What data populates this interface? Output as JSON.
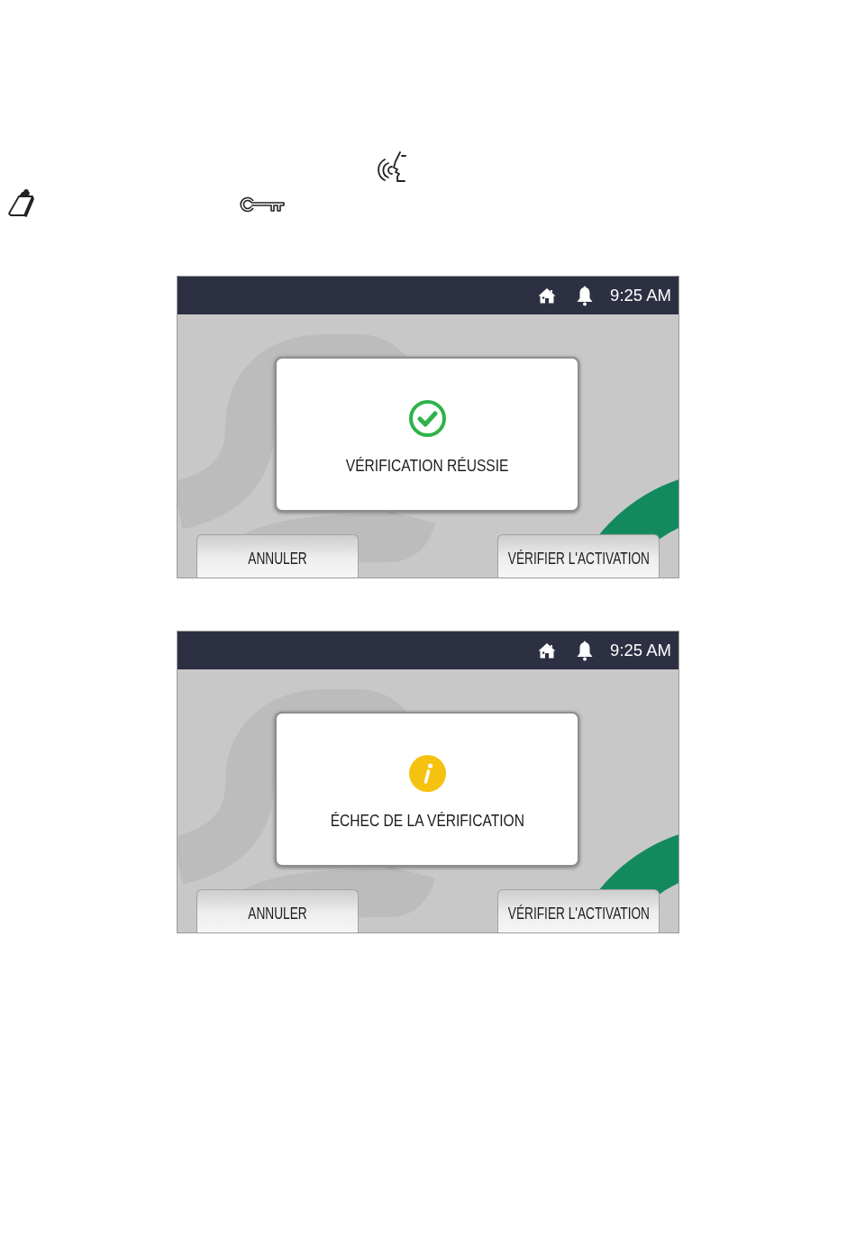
{
  "screens": [
    {
      "status_bar": {
        "time": "9:25 AM"
      },
      "dialog": {
        "kind": "success",
        "message": "VÉRIFICATION RÉUSSIE"
      },
      "buttons": [
        {
          "label": "ANNULER"
        },
        {
          "label": "VÉRIFIER L'ACTIVATION"
        }
      ]
    },
    {
      "status_bar": {
        "time": "9:25 AM"
      },
      "dialog": {
        "kind": "warning",
        "message": "ÉCHEC DE LA VÉRIFICATION"
      },
      "buttons": [
        {
          "label": "ANNULER"
        },
        {
          "label": "VÉRIFIER L'ACTIVATION"
        }
      ]
    }
  ]
}
